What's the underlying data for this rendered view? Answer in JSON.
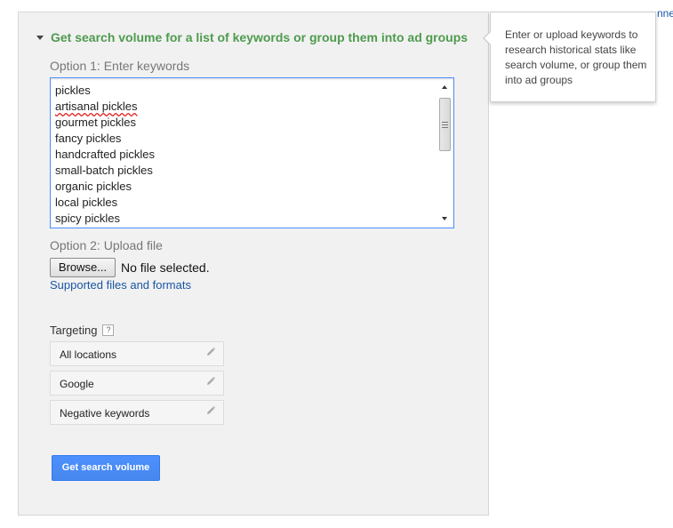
{
  "section": {
    "header": "Get search volume for a list of keywords or group them into ad groups"
  },
  "option1": {
    "label": "Option 1: Enter keywords",
    "keywords": [
      "pickles",
      "artisanal pickles",
      "gourmet pickles",
      "fancy pickles",
      "handcrafted pickles",
      "small-batch pickles",
      "organic pickles",
      "local pickles",
      "spicy pickles"
    ]
  },
  "option2": {
    "label": "Option 2: Upload file",
    "browse_label": "Browse...",
    "no_file_text": "No file selected.",
    "supported_link": "Supported files and formats"
  },
  "targeting": {
    "label": "Targeting",
    "help": "?",
    "items": [
      {
        "label": "All locations"
      },
      {
        "label": "Google"
      },
      {
        "label": "Negative keywords"
      }
    ]
  },
  "actions": {
    "primary": "Get search volume"
  },
  "tooltip": {
    "text": "Enter or upload keywords to research historical stats like search volume, or group them into ad groups"
  },
  "corner_link": "nne",
  "colors": {
    "header_green": "#4e9b4e",
    "link_blue": "#1a56a5",
    "primary_blue": "#4d90fe"
  }
}
